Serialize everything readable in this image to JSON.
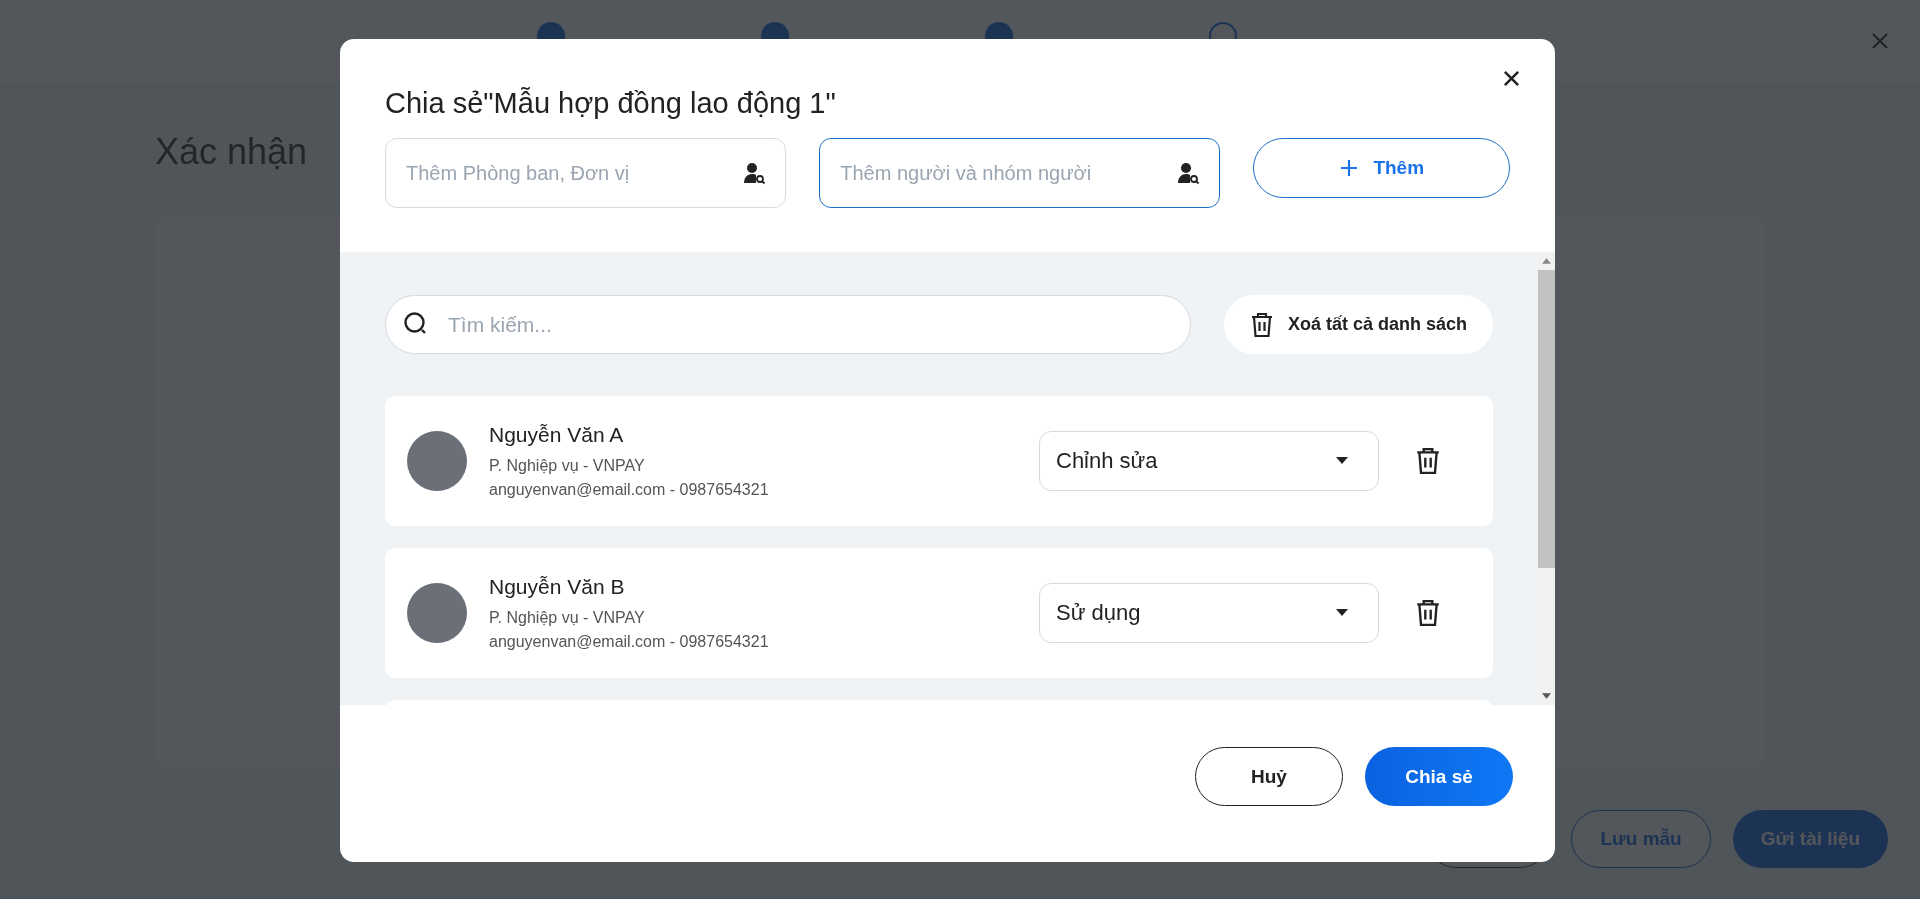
{
  "background_page": {
    "steps": [
      {
        "done": true
      },
      {
        "done": true
      },
      {
        "done": true
      },
      {
        "done": false
      }
    ],
    "title": "Xác nhận",
    "buttons": [
      {
        "kind": "outline"
      },
      {
        "label": "Lưu mẫu",
        "kind": "outline-primary"
      },
      {
        "label": "Gửi tài liệu",
        "kind": "primary"
      }
    ]
  },
  "dialog": {
    "title": "Chia sẻ\"Mẫu hợp đồng lao động 1\"",
    "department_field": {
      "placeholder": "Thêm Phòng ban, Đơn vị",
      "focused": false
    },
    "people_field": {
      "placeholder": "Thêm người và nhóm người",
      "focused": true
    },
    "add_button": "Thêm",
    "search": {
      "placeholder": "Tìm kiếm..."
    },
    "clear_all_button": "Xoá tất cả danh sách",
    "members": [
      {
        "name": "Nguyễn Văn A",
        "department": "P. Nghiệp vụ - VNPAY",
        "contact": "anguyenvan@email.com - 0987654321",
        "permission": "Chỉnh sửa"
      },
      {
        "name": "Nguyễn Văn B",
        "department": "P. Nghiệp vụ - VNPAY",
        "contact": "anguyenvan@email.com - 0987654321",
        "permission": "Sử dụng"
      }
    ],
    "cancel_button": "Huỷ",
    "share_button": "Chia sẻ"
  }
}
